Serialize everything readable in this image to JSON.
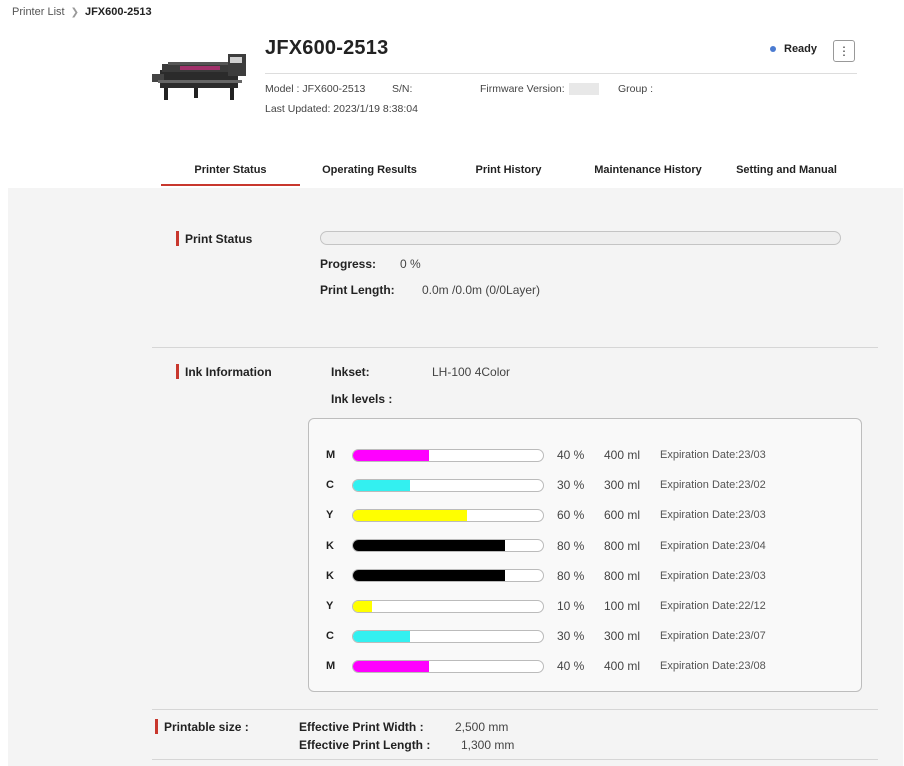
{
  "breadcrumb": {
    "root": "Printer List",
    "current": "JFX600-2513"
  },
  "header": {
    "title": "JFX600-2513",
    "status": "Ready",
    "status_color": "#4b7bd1",
    "model": "Model : JFX600-2513",
    "serial": "S/N:",
    "firmware": "Firmware Version:",
    "group": "Group :",
    "last_updated": "Last Updated: 2023/1/19 8:38:04",
    "menu_icon": "vertical-ellipsis-icon"
  },
  "tabs": [
    {
      "label": "Printer Status"
    },
    {
      "label": "Operating Results"
    },
    {
      "label": "Print History"
    },
    {
      "label": "Maintenance History"
    },
    {
      "label": "Setting and Manual"
    }
  ],
  "print_status": {
    "label": "Print Status",
    "progress_label": "Progress:",
    "progress_value": "0 %",
    "progress_fraction": 0,
    "length_label": "Print Length:",
    "length_value": "0.0m /0.0m (0/0Layer)"
  },
  "ink": {
    "label": "Ink Information",
    "inkset_label": "Inkset:",
    "inkset_value": "LH-100 4Color",
    "levels_label": "Ink levels :",
    "items": [
      {
        "letter": "M",
        "pct": "40 %",
        "level": 0.4,
        "ml": "400 ml",
        "exp": "Expiration Date:23/03",
        "color": "#ff00ff"
      },
      {
        "letter": "C",
        "pct": "30 %",
        "level": 0.3,
        "ml": "300 ml",
        "exp": "Expiration Date:23/02",
        "color": "#33f0f0"
      },
      {
        "letter": "Y",
        "pct": "60 %",
        "level": 0.6,
        "ml": "600 ml",
        "exp": "Expiration Date:23/03",
        "color": "#ffff00"
      },
      {
        "letter": "K",
        "pct": "80 %",
        "level": 0.8,
        "ml": "800 ml",
        "exp": "Expiration Date:23/04",
        "color": "#000000"
      },
      {
        "letter": "K",
        "pct": "80 %",
        "level": 0.8,
        "ml": "800 ml",
        "exp": "Expiration Date:23/03",
        "color": "#000000"
      },
      {
        "letter": "Y",
        "pct": "10 %",
        "level": 0.1,
        "ml": "100 ml",
        "exp": "Expiration Date:22/12",
        "color": "#ffff00"
      },
      {
        "letter": "C",
        "pct": "30 %",
        "level": 0.3,
        "ml": "300 ml",
        "exp": "Expiration Date:23/07",
        "color": "#33f0f0"
      },
      {
        "letter": "M",
        "pct": "40 %",
        "level": 0.4,
        "ml": "400 ml",
        "exp": "Expiration Date:23/08",
        "color": "#ff00ff"
      }
    ]
  },
  "printable": {
    "label": "Printable size :",
    "width_label": "Effective Print Width :",
    "width_value": "2,500 mm",
    "length_label": "Effective Print Length :",
    "length_value": "1,300 mm"
  },
  "colors": {
    "accent_red": "#c8372d",
    "status_blue": "#4b7bd1"
  }
}
